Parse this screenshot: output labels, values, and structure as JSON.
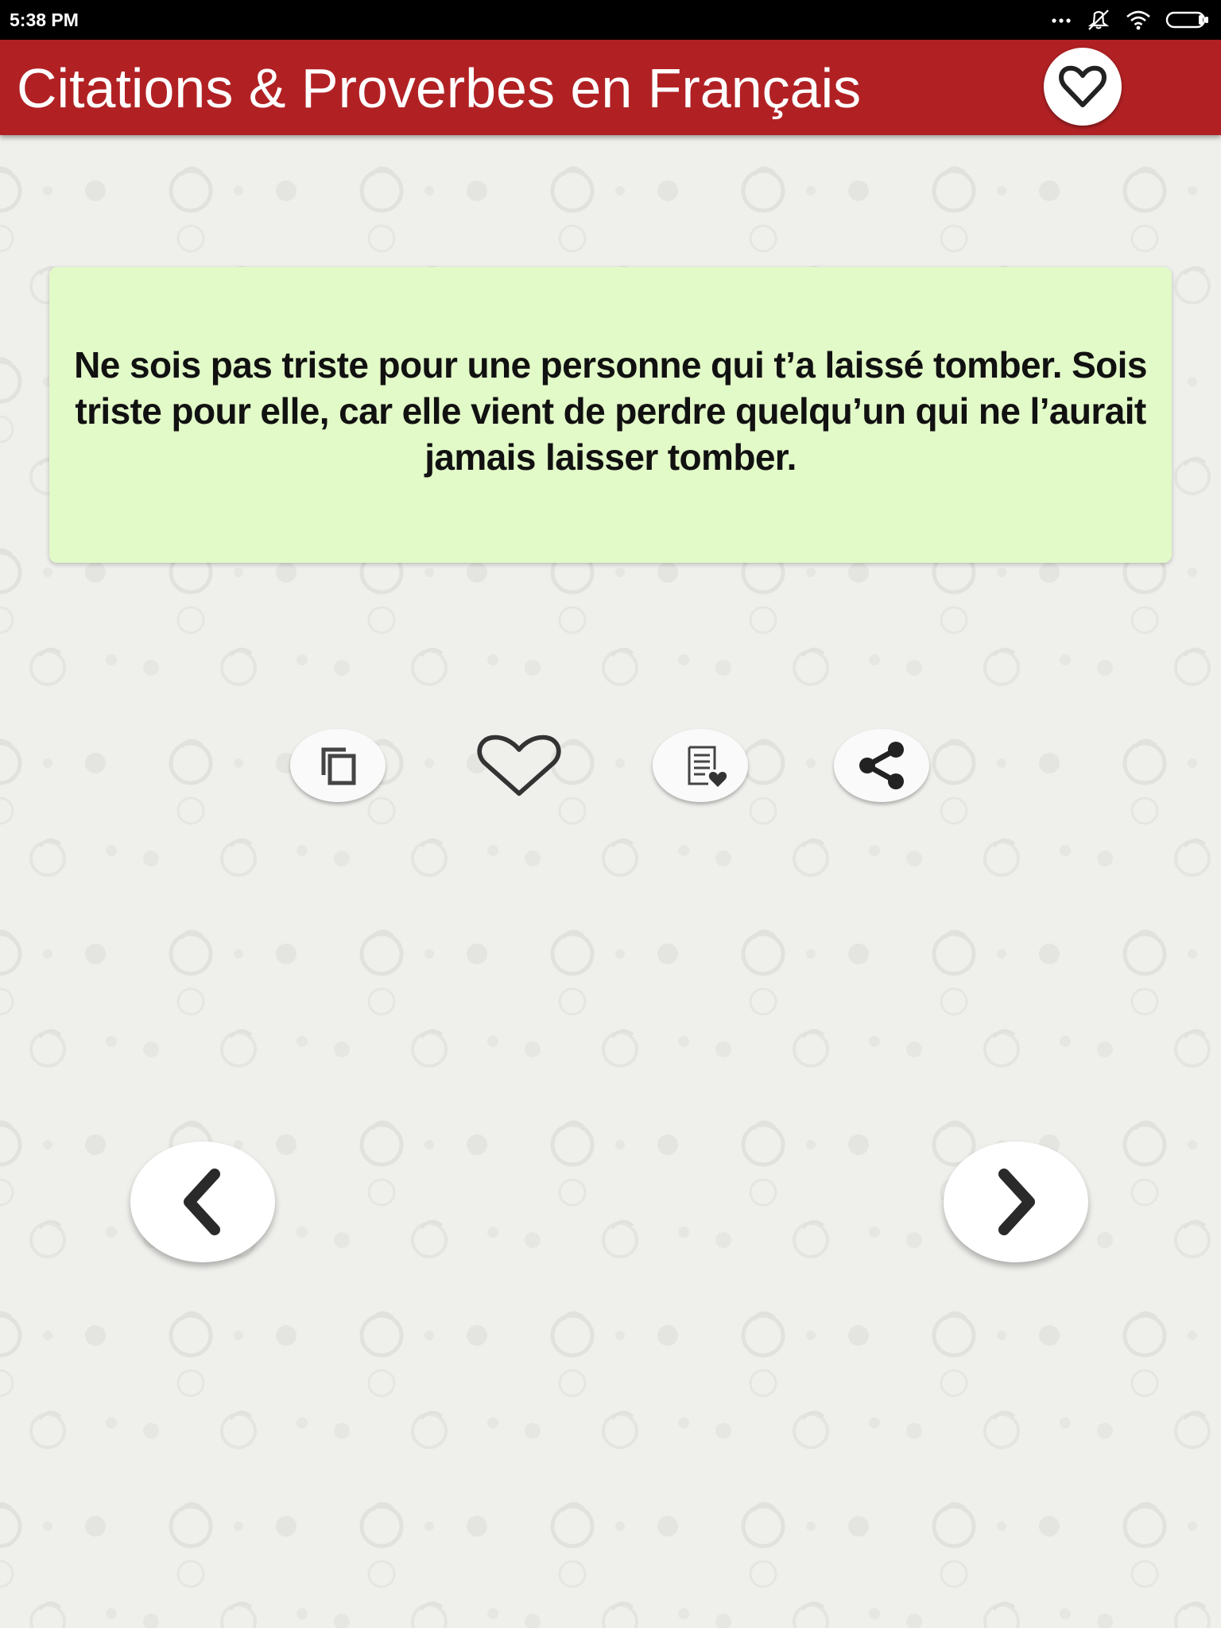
{
  "status_bar": {
    "time": "5:38 PM",
    "icons": [
      "more-dots-icon",
      "vibrate-icon",
      "wifi-icon",
      "battery-icon"
    ]
  },
  "app_bar": {
    "title": "Citations & Proverbes en Français",
    "favorites_icon": "heart-outline-icon"
  },
  "quote": {
    "text": "Ne sois pas triste pour une personne qui t’a laissé tomber. Sois triste pour elle, car elle vient de perdre quelqu’un qui ne l’aurait jamais laisser tomber."
  },
  "actions": [
    {
      "name": "copy",
      "icon": "copy-icon"
    },
    {
      "name": "favorite",
      "icon": "heart-outline-icon"
    },
    {
      "name": "favorites-list",
      "icon": "list-heart-icon"
    },
    {
      "name": "share",
      "icon": "share-icon"
    }
  ],
  "navigation": {
    "previous_icon": "chevron-left-icon",
    "next_icon": "chevron-right-icon"
  },
  "colors": {
    "app_bar": "#b12124",
    "card": "#e2f9c8",
    "background": "#efefec",
    "icon": "#333333"
  }
}
